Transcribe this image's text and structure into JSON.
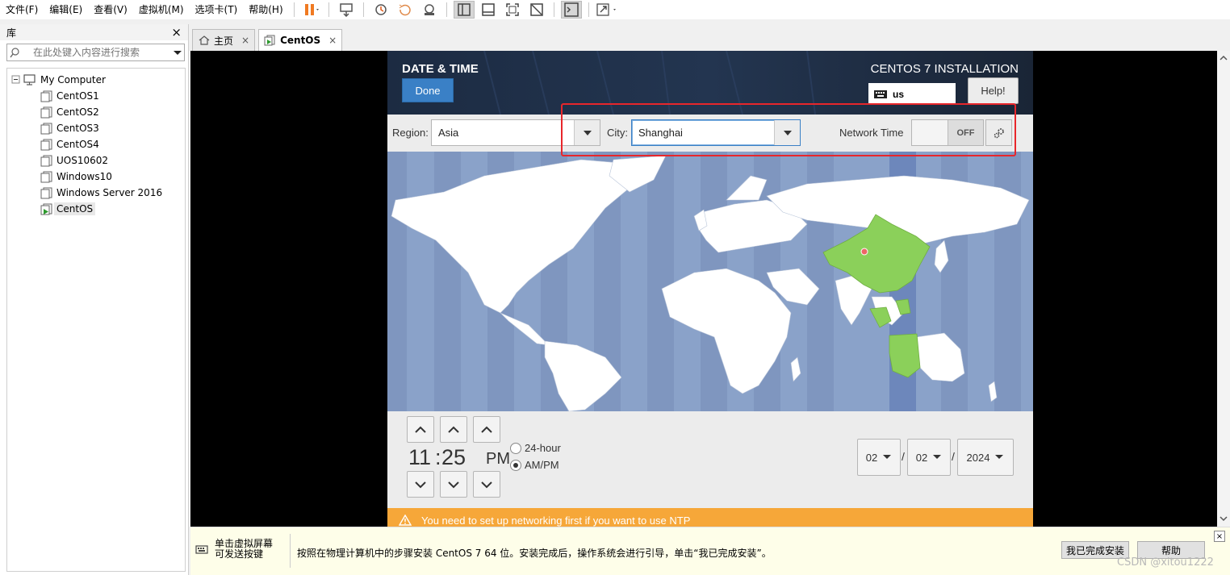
{
  "menubar": {
    "items": [
      "文件(F)",
      "编辑(E)",
      "查看(V)",
      "虚拟机(M)",
      "选项卡(T)",
      "帮助(H)"
    ]
  },
  "library": {
    "title": "库",
    "close": "×",
    "search_placeholder": "在此处键入内容进行搜索",
    "root": "My Computer",
    "vms": [
      "CentOS1",
      "CentOS2",
      "CentOS3",
      "CentOS4",
      "UOS10602",
      "Windows10",
      "Windows Server 2016",
      "CentOS"
    ],
    "selected": "CentOS"
  },
  "tabs": [
    {
      "label": "主页",
      "close": "×"
    },
    {
      "label": "CentOS",
      "close": "×"
    }
  ],
  "installer": {
    "title": "DATE & TIME",
    "done_label": "Done",
    "product": "CENTOS 7 INSTALLATION",
    "keyboard_layout": "us",
    "help_label": "Help!",
    "region_label": "Region:",
    "region_value": "Asia",
    "city_label": "City:",
    "city_value": "Shanghai",
    "network_time_label": "Network Time",
    "network_time_state": "OFF",
    "hour": "11",
    "colon": ":",
    "minute": "25",
    "ampm": "PM",
    "format_24h": "24-hour",
    "format_ampm": "AM/PM",
    "format_selected": "AM/PM",
    "month": "02",
    "day": "02",
    "year": "2024",
    "slash": "/",
    "warning": "You need to set up networking first if you want to use NTP"
  },
  "hintbar": {
    "left_line1": "单击虚拟屏幕",
    "left_line2": "可发送按键",
    "message": "按照在物理计算机中的步骤安装 CentOS 7 64 位。安装完成后，操作系统会进行引导，单击“我已完成安装”。",
    "finish_button": "我已完成安装",
    "help_button": "帮助",
    "close": "×"
  },
  "watermark": "CSDN @xitou1222",
  "colors": {
    "accent_blue": "#3a80c6",
    "warning_orange": "#f6a739",
    "selected_timezone_green": "#8bd05a",
    "highlight_red": "#e8262b",
    "map_ocean": "#8aa2c9"
  }
}
